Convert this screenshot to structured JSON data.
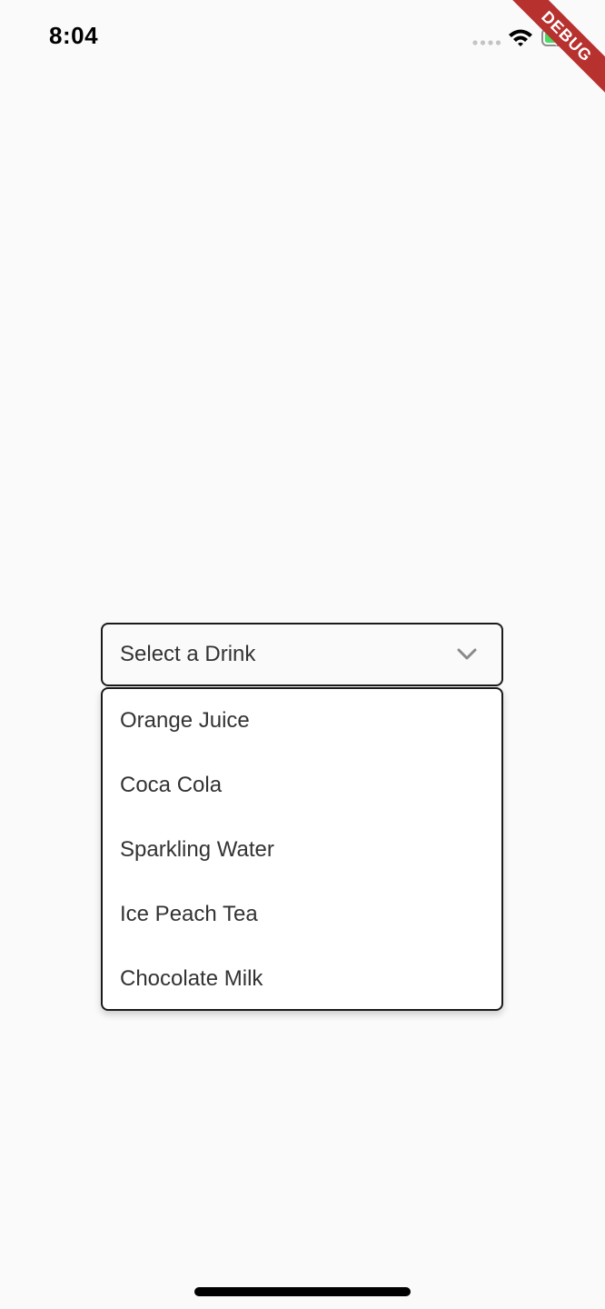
{
  "status_bar": {
    "time": "8:04",
    "icons": [
      "signal-dots-icon",
      "wifi-icon",
      "battery-charging-icon"
    ]
  },
  "debug_banner": {
    "label": "DEBUG",
    "color": "#b7312f"
  },
  "dropdown": {
    "label": "Select a Drink",
    "icon": "chevron-down-icon",
    "options": [
      "Orange Juice",
      "Coca Cola",
      "Sparkling Water",
      "Ice Peach Tea",
      "Chocolate Milk"
    ]
  },
  "colors": {
    "background": "#fafafa",
    "border": "#1a1a1a",
    "text": "#333333",
    "battery_fill": "#4cd964"
  }
}
